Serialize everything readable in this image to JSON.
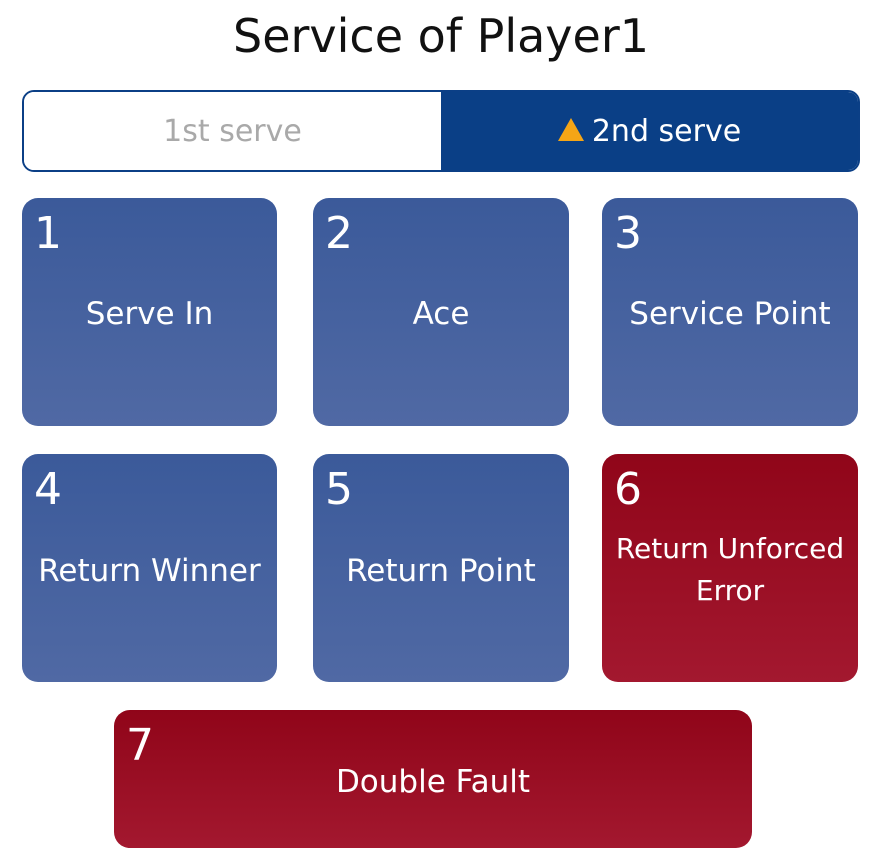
{
  "title": "Service of Player1",
  "serve_toggle": {
    "options": [
      "1st serve",
      "2nd serve"
    ],
    "selected": "2nd serve",
    "selected_icon": "warning-triangle-icon"
  },
  "buttons": [
    {
      "number": "1",
      "label": "Serve In",
      "color": "blue"
    },
    {
      "number": "2",
      "label": "Ace",
      "color": "blue"
    },
    {
      "number": "3",
      "label": "Service Point",
      "color": "blue"
    },
    {
      "number": "4",
      "label": "Return Winner",
      "color": "blue"
    },
    {
      "number": "5",
      "label": "Return Point",
      "color": "blue"
    },
    {
      "number": "6",
      "label_lines": [
        "Return Unforced",
        "Error"
      ],
      "color": "red"
    },
    {
      "number": "7",
      "label": "Double Fault",
      "color": "red"
    }
  ],
  "colors": {
    "blue": "#4a64a0",
    "red": "#99101f",
    "accent": "#0a3f86",
    "warning": "#f5a516"
  }
}
